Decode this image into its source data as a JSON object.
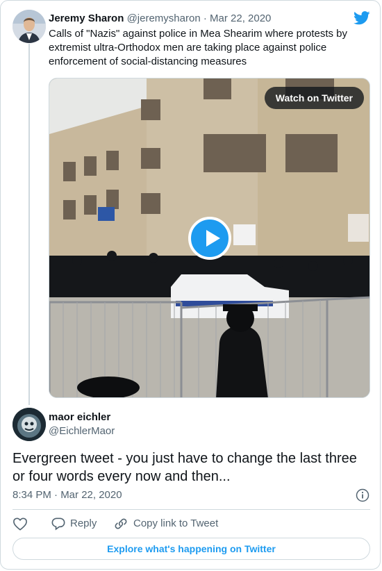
{
  "parent_tweet": {
    "name": "Jeremy Sharon",
    "handle": "@jeremysharon",
    "separator": "·",
    "date": "Mar 22, 2020",
    "text": "Calls of \"Nazis\" against police in Mea Shearim where protests by extremist ultra-Orthodox men are taking place against police enforcement of social-distancing measures",
    "media": {
      "watch_label": "Watch on Twitter"
    }
  },
  "reply_tweet": {
    "name": "maor eichler",
    "handle": "@EichlerMaor",
    "text": "Evergreen tweet - you just have to change the last three or four words every now and then...",
    "timestamp": "8:34 PM · Mar 22, 2020"
  },
  "actions": {
    "reply_label": "Reply",
    "copy_link_label": "Copy link to Tweet"
  },
  "footer": {
    "explore_label": "Explore what's happening on Twitter"
  },
  "icons": {
    "brand": "twitter-bird-icon",
    "info": "info-icon",
    "like": "heart-icon",
    "reply": "reply-bubble-icon",
    "link": "link-icon",
    "play": "play-icon"
  },
  "colors": {
    "accent": "#1d9bf0",
    "text": "#0f1419",
    "muted": "#536471",
    "border": "#cfd9de"
  }
}
